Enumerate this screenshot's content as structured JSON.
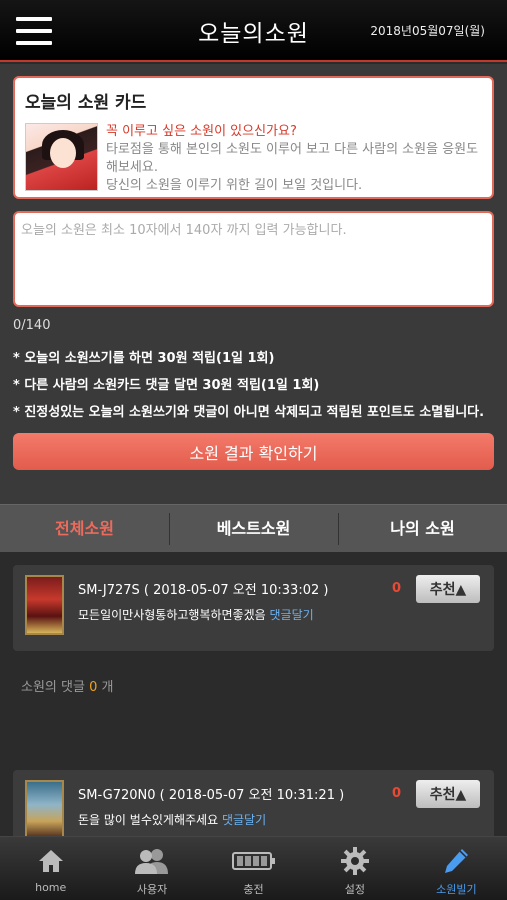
{
  "header": {
    "title": "오늘의소원",
    "date": "2018년05월07일(월)"
  },
  "wish_card": {
    "title": "오늘의 소원 카드",
    "highlight": "꼭 이루고 싶은 소원이 있으신가요?",
    "line2": "타로점을 통해 본인의 소원도 이루어 보고 다른 사람의 소원을 응원도 해보세요.",
    "line3": "당신의 소원을 이루기 위한 길이 보일 것입니다."
  },
  "wish_input": {
    "placeholder": "오늘의 소원은 최소 10자에서 140자 까지 입력 가능합니다.",
    "value": "",
    "counter": "0/140"
  },
  "notes": [
    "* 오늘의 소원쓰기를 하면 30원 적립(1일 1회)",
    "* 다른 사람의 소원카드 댓글 달면 30원 적립(1일 1회)",
    "* 진정성있는 오늘의 소원쓰기와 댓글이 아니면 삭제되고 적립된 포인트도 소멸됩니다."
  ],
  "submit_label": "소원 결과 확인하기",
  "tabs": [
    "전체소원",
    "베스트소원",
    "나의 소원"
  ],
  "posts": [
    {
      "meta": "SM-J727S ( 2018-05-07 오전 10:33:02 )",
      "text": "모든일이만사형통하고행복하면좋겠음",
      "reply_label": "댓글달기",
      "likes": "0",
      "like_label": "추천▲",
      "comments_prefix": "소원의 댓글",
      "comments_count": "0",
      "comments_suffix": "개"
    },
    {
      "meta": "SM-G720N0 ( 2018-05-07 오전 10:31:21 )",
      "text": "돈을 많이 벌수있게해주세요",
      "reply_label": "댓글달기",
      "likes": "0",
      "like_label": "추천▲"
    }
  ],
  "bottom_nav": [
    {
      "label": "home",
      "icon": "home-icon"
    },
    {
      "label": "사용자",
      "icon": "users-icon"
    },
    {
      "label": "충전",
      "icon": "battery-icon"
    },
    {
      "label": "설정",
      "icon": "gear-icon"
    },
    {
      "label": "소원빌기",
      "icon": "pen-icon"
    }
  ],
  "colors": {
    "accent": "#e25c4c",
    "active_nav": "#4a9cf0",
    "link": "#6cb1f0"
  }
}
